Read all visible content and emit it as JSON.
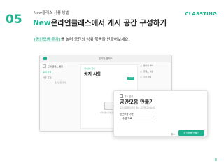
{
  "header": {
    "step_number": "05",
    "subtitle": "New클래스 사용 방법",
    "title_accent": "New",
    "title_rest": "온라인클래스에서 게시 공간 구성하기",
    "brand": "CLASSTING"
  },
  "description": {
    "highlight": "[공간모음 추가]",
    "rest": "를 눌러 공간의 상위 묶음을 만들어보세요."
  },
  "screenshot": {
    "window_title": "온라인 클래스",
    "sidebar": {
      "items": [
        {
          "label": "전체 클래스 공간"
        },
        {
          "label": "공지 사항"
        },
        {
          "label": "자유 공간"
        }
      ],
      "group_label": "공간모음 추가"
    },
    "main": {
      "breadcrumb": "게시판 / 공지",
      "title": "공지 사항",
      "write_button": "글쓰기",
      "empty_text": "아직 게시글이 없습니다"
    },
    "right_pane": {
      "items": [
        {
          "label": "참여자 관리"
        },
        {
          "label": "클래스 설정"
        },
        {
          "label": "수업 관리"
        }
      ]
    }
  },
  "dialog": {
    "crumb": "게시 공간",
    "title": "공간모음 만들기",
    "subtitle": "공간모음을 만들어 게시 공간을 묶어보세요.",
    "field_label": "공간모음 이름",
    "field_value": "수업 자료",
    "cancel_label": "취소",
    "create_label": "공간모음 만들기"
  },
  "page_number": "8",
  "colors": {
    "accent": "#1db38f"
  }
}
